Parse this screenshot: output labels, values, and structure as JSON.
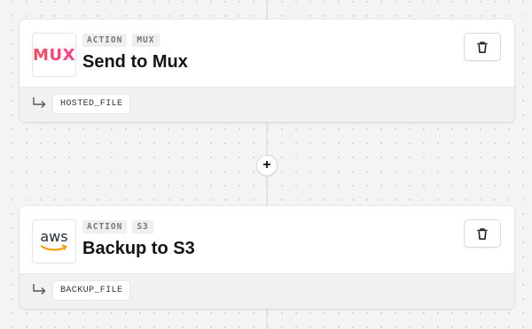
{
  "steps": [
    {
      "tags": [
        "ACTION",
        "MUX"
      ],
      "title": "Send to Mux",
      "logo": {
        "icon": "mux-logo",
        "text": "MUX"
      },
      "output": "HOSTED_FILE"
    },
    {
      "tags": [
        "ACTION",
        "S3"
      ],
      "title": "Backup to S3",
      "logo": {
        "icon": "aws-logo",
        "text": "aws"
      },
      "output": "BACKUP_FILE"
    }
  ],
  "add_step_label": "+",
  "colors": {
    "mux_brand": "#ff3d6e",
    "aws_text": "#232f3e",
    "aws_smile": "#ff9900"
  }
}
